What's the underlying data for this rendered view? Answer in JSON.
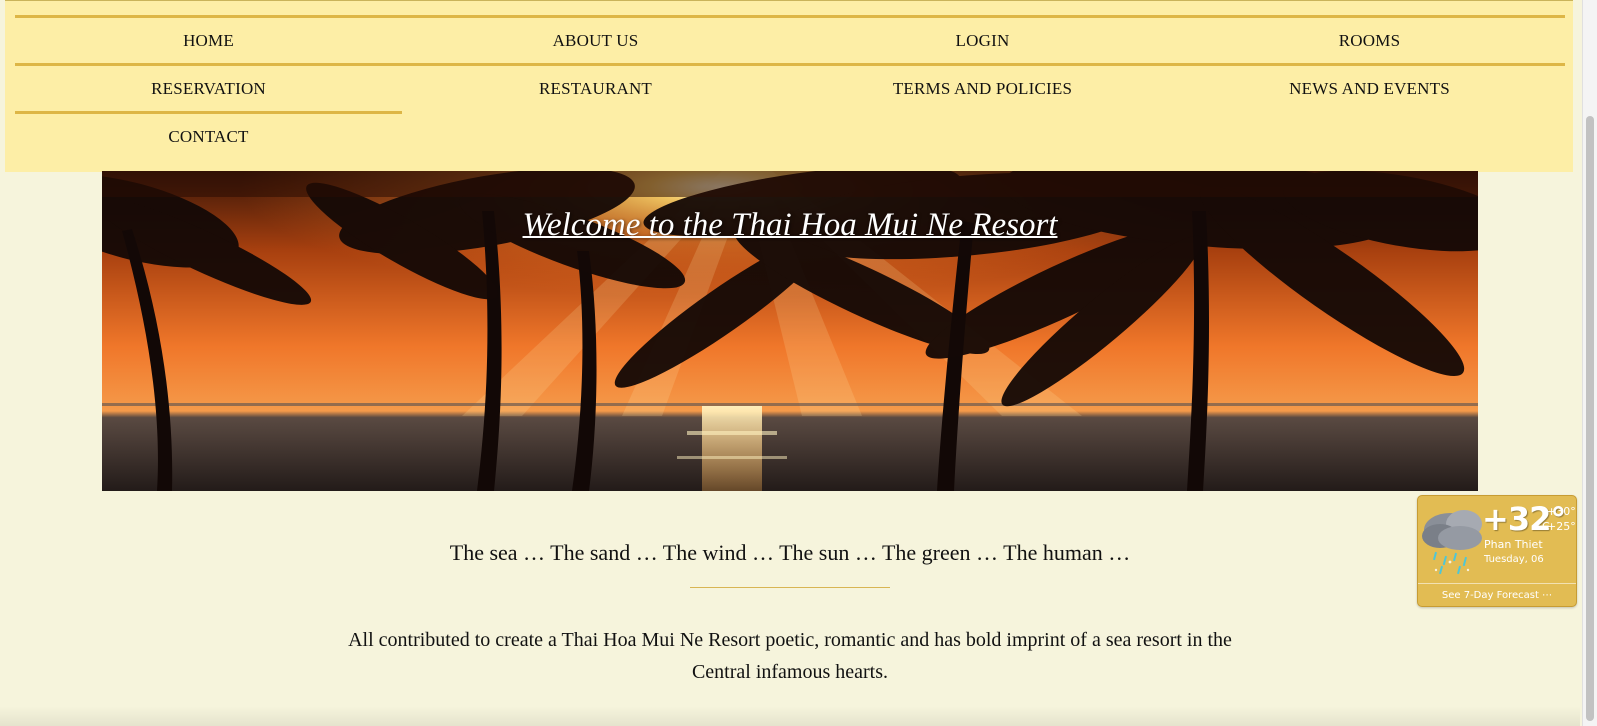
{
  "nav": {
    "items": [
      {
        "label": "HOME"
      },
      {
        "label": "ABOUT US"
      },
      {
        "label": "LOGIN"
      },
      {
        "label": "ROOMS"
      },
      {
        "label": "RESERVATION"
      },
      {
        "label": "RESTAURANT"
      },
      {
        "label": "TERMS AND POLICIES"
      },
      {
        "label": "NEWS AND EVENTS"
      },
      {
        "label": "CONTACT"
      }
    ]
  },
  "hero": {
    "title": "Welcome to the Thai Hoa Mui Ne Resort"
  },
  "content": {
    "tagline": "The sea … The sand … The wind … The sun … The green … The human …",
    "description": "All contributed to create a Thai Hoa Mui Ne Resort poetic, romantic and has bold imprint of a sea resort in the Central infamous hearts."
  },
  "weather": {
    "icon": "rain-cloud-icon",
    "temperature": "+32°",
    "unit": "C",
    "high": "+30°",
    "low": "+25°",
    "city": "Phan Thiet",
    "date": "Tuesday, 06",
    "forecast_link": "See 7-Day Forecast ⋯"
  },
  "colors": {
    "page_background": "#f6f4dc",
    "nav_background": "#fdeea6",
    "nav_divider": "#ddb646",
    "widget_background": "#e2bc53"
  }
}
